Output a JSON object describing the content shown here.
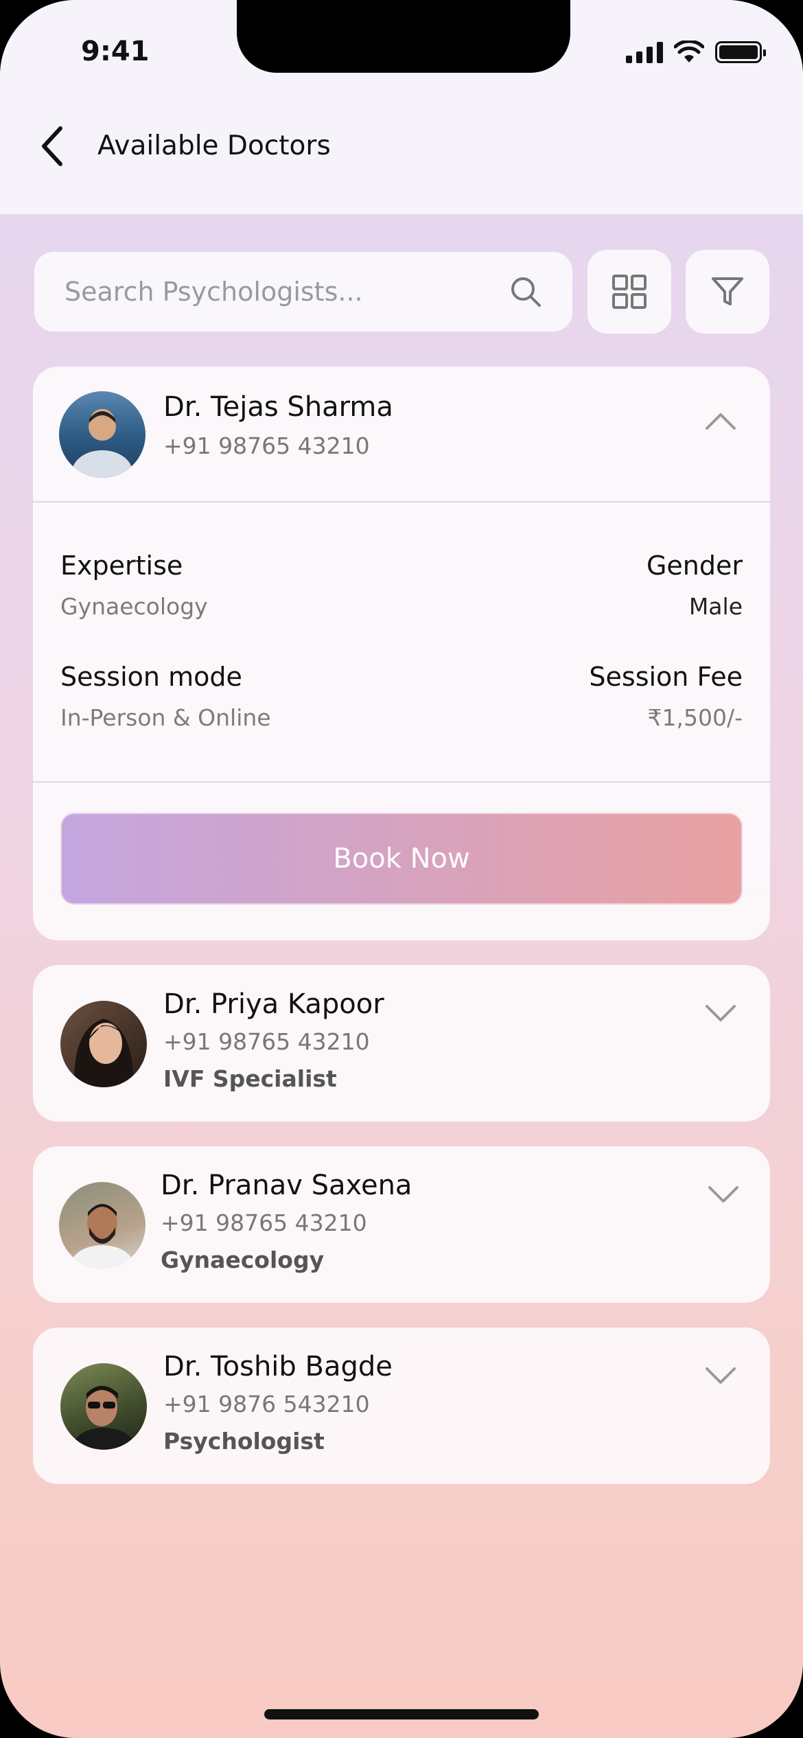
{
  "status_bar": {
    "time": "9:41"
  },
  "header": {
    "title": "Available Doctors"
  },
  "search": {
    "placeholder": "Search Psychologists..."
  },
  "toolbar": {
    "grid_icon": "grid-icon",
    "filter_icon": "filter-icon"
  },
  "expanded_doctor": {
    "name": "Dr. Tejas Sharma",
    "phone": "+91 98765 43210",
    "fields": {
      "expertise_label": "Expertise",
      "expertise_value": "Gynaecology",
      "gender_label": "Gender",
      "gender_value": "Male",
      "mode_label": "Session mode",
      "mode_value": "In-Person & Online",
      "fee_label": "Session Fee",
      "fee_value": "₹1,500/-"
    },
    "book_label": "Book Now"
  },
  "doctors": [
    {
      "name": "Dr. Priya Kapoor",
      "phone": "+91 98765 43210",
      "specialty": "IVF Specialist"
    },
    {
      "name": "Dr. Pranav Saxena",
      "phone": "+91 98765 43210",
      "specialty": "Gynaecology"
    },
    {
      "name": "Dr. Toshib Bagde",
      "phone": "+91 9876 543210",
      "specialty": "Psychologist"
    }
  ],
  "colors": {
    "accent_start": "#c4a6e0",
    "accent_end": "#e8a1a1",
    "background_top": "#e3d8f2",
    "background_bottom": "#f8cbc4"
  }
}
